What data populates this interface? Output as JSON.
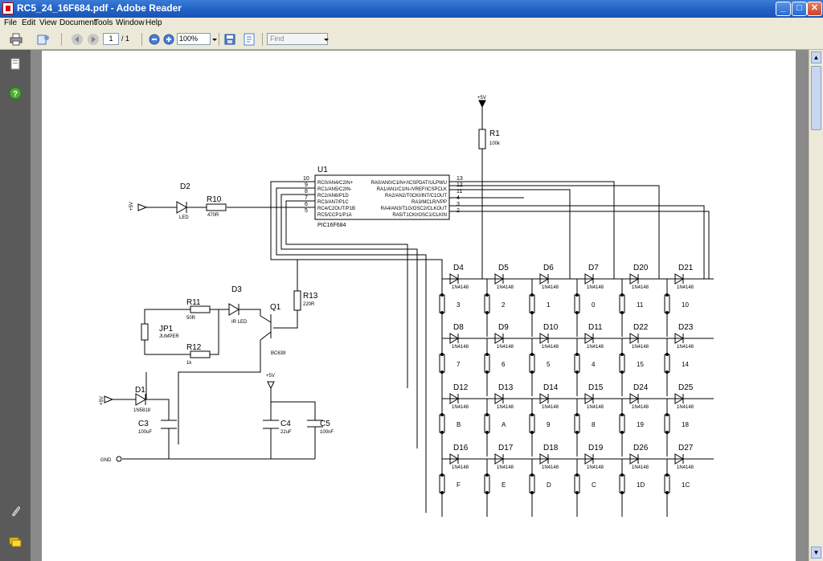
{
  "window": {
    "title": "RC5_24_16F684.pdf - Adobe Reader"
  },
  "menu": [
    "File",
    "Edit",
    "View",
    "Document",
    "Tools",
    "Window",
    "Help"
  ],
  "toolbar": {
    "page_current": "1",
    "page_total": "/ 1",
    "zoom": "100%",
    "find_placeholder": "Find"
  },
  "icons": {
    "print": "printer-icon",
    "save": "save-icon",
    "prev": "previous-page-icon",
    "next": "next-page-icon",
    "zoom_out": "zoom-out-icon",
    "zoom_in": "zoom-in-icon",
    "pages": "pages-panel-icon",
    "help": "help-icon",
    "attach": "paperclip-icon",
    "comments": "comments-icon"
  },
  "schematic": {
    "u1": {
      "ref": "U1",
      "part": "PIC16F684",
      "left_pins": [
        {
          "num": "10",
          "name": "RC0/AN4/C2IN+"
        },
        {
          "num": "9",
          "name": "RC1/AN5/C2IN-"
        },
        {
          "num": "8",
          "name": "RC2/AN6/P1D"
        },
        {
          "num": "7",
          "name": "RC3/AN7/P1C"
        },
        {
          "num": "6",
          "name": "RC4/C2OUT/P1B"
        },
        {
          "num": "5",
          "name": "RC5/CCP1/P1A"
        }
      ],
      "right_pins": [
        {
          "num": "13",
          "name": "RA0/AN0/C1IN+/ICSPDAT/ULPWU"
        },
        {
          "num": "12",
          "name": "RA1/AN1/C1IN-/VREF/ICSPCLK"
        },
        {
          "num": "11",
          "name": "RA2/AN2/T0CKI/INT/C1OUT"
        },
        {
          "num": "4",
          "name": "RA3/MCLR/VPP"
        },
        {
          "num": "3",
          "name": "RA4/AN3/T1G/OSC2/CLKOUT"
        },
        {
          "num": "2",
          "name": "RA5/T1CKI/OSC1/CLKIN"
        }
      ]
    },
    "components": {
      "r1": {
        "ref": "R1",
        "value": "100k"
      },
      "r10": {
        "ref": "R10",
        "value": "470R"
      },
      "r11": {
        "ref": "R11",
        "value": "50R"
      },
      "r12": {
        "ref": "R12",
        "value": "1k"
      },
      "r13": {
        "ref": "R13",
        "value": "220R"
      },
      "d1": {
        "ref": "D1",
        "value": "1N5818"
      },
      "d2": {
        "ref": "D2",
        "value": "LED"
      },
      "d3": {
        "ref": "D3",
        "value": "IR LED"
      },
      "q1": {
        "ref": "Q1",
        "value": "BC639"
      },
      "jp1": {
        "ref": "JP1",
        "value": "JUMPER"
      },
      "c3": {
        "ref": "C3",
        "value": "100uF"
      },
      "c4": {
        "ref": "C4",
        "value": "22uF"
      },
      "c5": {
        "ref": "C5",
        "value": "100nF"
      }
    },
    "power": {
      "vcc": "+5V",
      "gnd": "GND"
    },
    "diode_part": "1N4148",
    "matrix": [
      [
        {
          "d": "D4",
          "k": "3"
        },
        {
          "d": "D5",
          "k": "2"
        },
        {
          "d": "D6",
          "k": "1"
        },
        {
          "d": "D7",
          "k": "0"
        },
        {
          "d": "D20",
          "k": "11"
        },
        {
          "d": "D21",
          "k": "10"
        }
      ],
      [
        {
          "d": "D8",
          "k": "7"
        },
        {
          "d": "D9",
          "k": "6"
        },
        {
          "d": "D10",
          "k": "5"
        },
        {
          "d": "D11",
          "k": "4"
        },
        {
          "d": "D22",
          "k": "15"
        },
        {
          "d": "D23",
          "k": "14"
        }
      ],
      [
        {
          "d": "D12",
          "k": "B"
        },
        {
          "d": "D13",
          "k": "A"
        },
        {
          "d": "D14",
          "k": "9"
        },
        {
          "d": "D15",
          "k": "8"
        },
        {
          "d": "D24",
          "k": "19"
        },
        {
          "d": "D25",
          "k": "18"
        }
      ],
      [
        {
          "d": "D16",
          "k": "F"
        },
        {
          "d": "D17",
          "k": "E"
        },
        {
          "d": "D18",
          "k": "D"
        },
        {
          "d": "D19",
          "k": "C"
        },
        {
          "d": "D26",
          "k": "1D"
        },
        {
          "d": "D27",
          "k": "1C"
        }
      ]
    ]
  }
}
